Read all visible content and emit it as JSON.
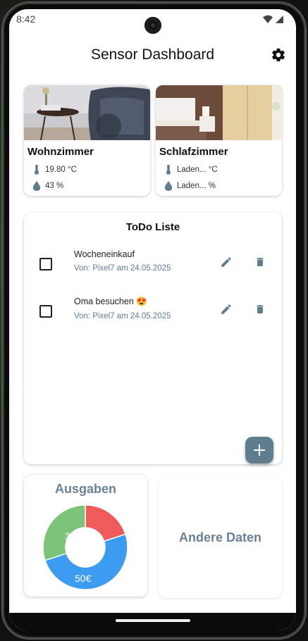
{
  "status_bar": {
    "time": "8:42"
  },
  "app_bar": {
    "title": "Sensor Dashboard"
  },
  "rooms": [
    {
      "name": "Wohnzimmer",
      "temperature": "19.80 °C",
      "humidity": "43 %"
    },
    {
      "name": "Schlafzimmer",
      "temperature": "Laden... °C",
      "humidity": "Laden... %"
    }
  ],
  "todo": {
    "title": "ToDo Liste",
    "items": [
      {
        "title": "Wocheneinkauf",
        "subtitle": "Von: Pixel7 am 24.05.2025",
        "checked": false
      },
      {
        "title": "Oma besuchen 😍",
        "subtitle": "Von: Pixel7 am 24.05.2025",
        "checked": false
      }
    ]
  },
  "ausgaben": {
    "title": "Ausgaben",
    "labels": [
      "30€",
      "50€"
    ]
  },
  "andere": {
    "title": "Andere Daten"
  },
  "chart_data": {
    "type": "pie",
    "title": "Ausgaben",
    "categories": [
      "red",
      "green",
      "blue"
    ],
    "values": [
      20,
      30,
      50
    ],
    "colors": [
      "#ef5a5a",
      "#7cc47a",
      "#3d9bf0"
    ]
  },
  "colors": {
    "accent": "#5e7d8f",
    "subtitle": "#5e7d91",
    "card_title": "#6b8294"
  }
}
